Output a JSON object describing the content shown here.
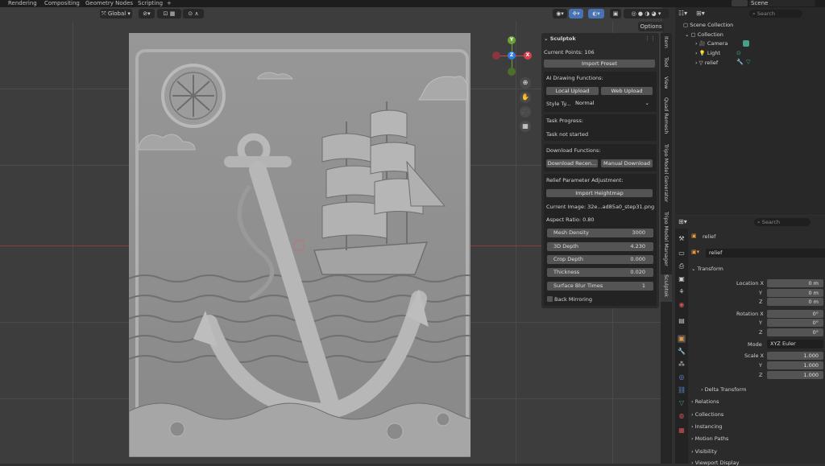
{
  "top_tabs": [
    "Rendering",
    "Compositing",
    "Geometry Nodes",
    "Scripting",
    "+"
  ],
  "scene_name": "Scene",
  "viewport": {
    "transform_orientation": "Global",
    "options_label": "Options",
    "gizmo": {
      "x": "X",
      "y": "Y",
      "z": "Z"
    }
  },
  "sculptok": {
    "title": "Sculptok",
    "current_points": "Current Points: 106",
    "import_preset": "Import Preset",
    "ai_drawing_label": "AI Drawing Functions:",
    "local_upload": "Local Upload",
    "web_upload": "Web Upload",
    "style_type_label": "Style Ty...",
    "style_type_value": "Normal",
    "task_progress_label": "Task Progress:",
    "task_status": "Task not started",
    "download_label": "Download Functions:",
    "download_recent": "Download Recen...",
    "manual_download": "Manual Download",
    "relief_param_label": "Relief Parameter Adjustment:",
    "import_heightmap": "Import Heightmap",
    "current_image": "Current Image: 32e...ad85a0_step31.png",
    "aspect_ratio": "Aspect Ratio: 0.80",
    "fields": [
      {
        "label": "Mesh Density",
        "value": "3000"
      },
      {
        "label": "3D Depth",
        "value": "4.230"
      },
      {
        "label": "Crop Depth",
        "value": "0.000"
      },
      {
        "label": "Thickness",
        "value": "0.020"
      },
      {
        "label": "Surface Blur Times",
        "value": "1"
      }
    ],
    "back_mirroring": "Back Mirroring"
  },
  "side_tabs": [
    "Item",
    "Tool",
    "View",
    "Quad Remesh",
    "Tripo Model Generator",
    "Tripo Model Manager",
    "Sculptok"
  ],
  "outliner": {
    "search_placeholder": "Search",
    "scene_collection": "Scene Collection",
    "collection": "Collection",
    "items": [
      "Camera",
      "Light",
      "relief"
    ]
  },
  "properties": {
    "search_placeholder": "Search",
    "object_name": "relief",
    "object_field": "relief",
    "transform_label": "Transform",
    "location_x_label": "Location X",
    "rotation_x_label": "Rotation X",
    "scale_x_label": "Scale X",
    "y_label": "Y",
    "z_label": "Z",
    "mode_label": "Mode",
    "mode_value": "XYZ Euler",
    "location": [
      "0 m",
      "0 m",
      "0 m"
    ],
    "rotation": [
      "0°",
      "0°",
      "0°"
    ],
    "scale": [
      "1.000",
      "1.000",
      "1.000"
    ],
    "delta_transform": "Delta Transform",
    "sections": [
      "Relations",
      "Collections",
      "Instancing",
      "Motion Paths",
      "Visibility",
      "Viewport Display"
    ]
  },
  "colors": {
    "accent": "#4772b3",
    "axis_x": "#d8404c",
    "axis_y": "#6ea234",
    "axis_z": "#2e7ce0"
  }
}
